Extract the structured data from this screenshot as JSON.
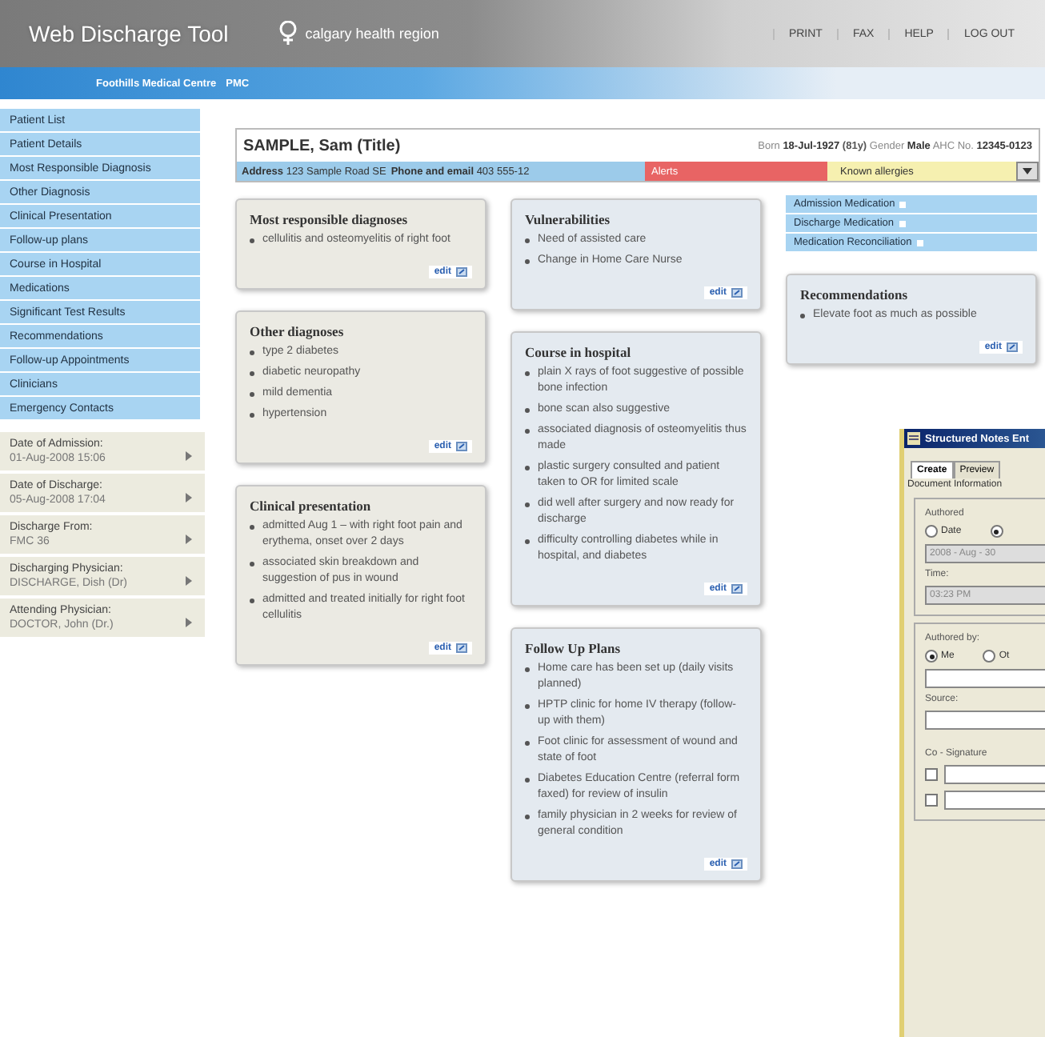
{
  "header": {
    "title": "Web Discharge Tool",
    "org": "calgary health region",
    "links": [
      "PRINT",
      "FAX",
      "HELP",
      "LOG OUT"
    ]
  },
  "facility": {
    "name": "Foothills Medical Centre",
    "code": "PMC"
  },
  "sidebar": {
    "items": [
      {
        "label": "Patient List"
      },
      {
        "label": "Patient Details"
      },
      {
        "label": "Most Responsible Diagnosis"
      },
      {
        "label": "Other Diagnosis"
      },
      {
        "label": "Clinical Presentation"
      },
      {
        "label": "Follow-up plans"
      },
      {
        "label": "Course in Hospital"
      },
      {
        "label": "Medications"
      },
      {
        "label": "Significant Test Results"
      },
      {
        "label": "Recommendations"
      },
      {
        "label": "Follow-up Appointments"
      },
      {
        "label": "Clinicians"
      },
      {
        "label": "Emergency Contacts"
      }
    ],
    "details": [
      {
        "label": "Date of Admission:",
        "value": "01-Aug-2008  15:06"
      },
      {
        "label": "Date of Discharge:",
        "value": "05-Aug-2008  17:04"
      },
      {
        "label": "Discharge From:",
        "value": "FMC 36"
      },
      {
        "label": "Discharging Physician:",
        "value": "DISCHARGE, Dish (Dr)"
      },
      {
        "label": "Attending Physician:",
        "value": "DOCTOR, John (Dr.)"
      }
    ]
  },
  "patient": {
    "name": "SAMPLE, Sam (Title)",
    "born_label": "Born",
    "born": "18-Jul-1927",
    "age": "(81y)",
    "gender_label": "Gender",
    "gender": "Male",
    "ahc_label": "AHC No.",
    "ahc": "12345-0123",
    "address_label": "Address",
    "address": "123 Sample Road SE",
    "phone_label": "Phone and email",
    "phone": "403 555-12",
    "alerts": "Alerts",
    "allergies": "Known allergies"
  },
  "columns": [
    [
      {
        "kind": "card",
        "title": "Most responsible diagnoses",
        "items": [
          "cellulitis and osteomyelitis of right foot"
        ],
        "edit": "edit"
      },
      {
        "kind": "card",
        "title": "Other diagnoses",
        "items": [
          "type 2 diabetes",
          "diabetic neuropathy",
          "mild dementia",
          "hypertension"
        ],
        "edit": "edit"
      },
      {
        "kind": "card",
        "title": "Clinical presentation",
        "items": [
          "admitted Aug 1 – with right foot pain and erythema, onset over 2 days",
          "associated skin breakdown and suggestion of pus in wound",
          "admitted and treated initially for right foot cellulitis"
        ],
        "edit": "edit"
      }
    ],
    [
      {
        "kind": "card",
        "title": "Vulnerabilities",
        "items": [
          "Need of assisted care",
          "Change in Home Care Nurse"
        ],
        "edit": "edit"
      },
      {
        "kind": "card",
        "title": "Course in hospital",
        "items": [
          "plain X rays of foot suggestive of possible bone infection",
          "bone scan also suggestive",
          "associated diagnosis of osteomyelitis thus made",
          "plastic surgery consulted and patient taken to OR for limited scale",
          "did well after surgery and now ready for discharge",
          "difficulty controlling diabetes while in hospital, and diabetes"
        ],
        "edit": "edit"
      },
      {
        "kind": "card",
        "title": "Follow Up Plans",
        "items": [
          "Home care has been set up (daily visits planned)",
          "HPTP clinic for home IV therapy (follow-up with them)",
          "Foot clinic for assessment of wound and state of foot",
          "Diabetes Education Centre (referral form faxed) for review of insulin",
          "family physician in 2 weeks for review of general condition"
        ],
        "edit": "edit"
      }
    ],
    [
      {
        "kind": "links",
        "items": [
          "Admission Medication",
          "Discharge Medication",
          "Medication Reconciliation"
        ]
      },
      {
        "kind": "card",
        "title": "Recommendations",
        "items": [
          "Elevate foot as much as possible"
        ],
        "edit": "edit"
      }
    ]
  ],
  "notes_window": {
    "title": "Structured Notes Ent",
    "tabs": [
      {
        "label": "Create",
        "selected": true
      },
      {
        "label": "Preview",
        "selected": false
      }
    ],
    "section": "Document Information",
    "authored": {
      "label": "Authored",
      "options": [
        {
          "label": "Date",
          "selected": false
        },
        {
          "selected": true
        }
      ],
      "date": "2008 - Aug - 30",
      "time_label": "Time:",
      "time": "03:23 PM"
    },
    "authored_by": {
      "label": "Authored by:",
      "options": [
        {
          "label": "Me",
          "selected": true
        },
        {
          "label": "Ot",
          "selected": false
        }
      ],
      "source_label": "Source:"
    },
    "cosign": {
      "label": "Co - Signature",
      "rows": [
        {
          "checked": false
        },
        {
          "checked": false
        }
      ]
    }
  }
}
